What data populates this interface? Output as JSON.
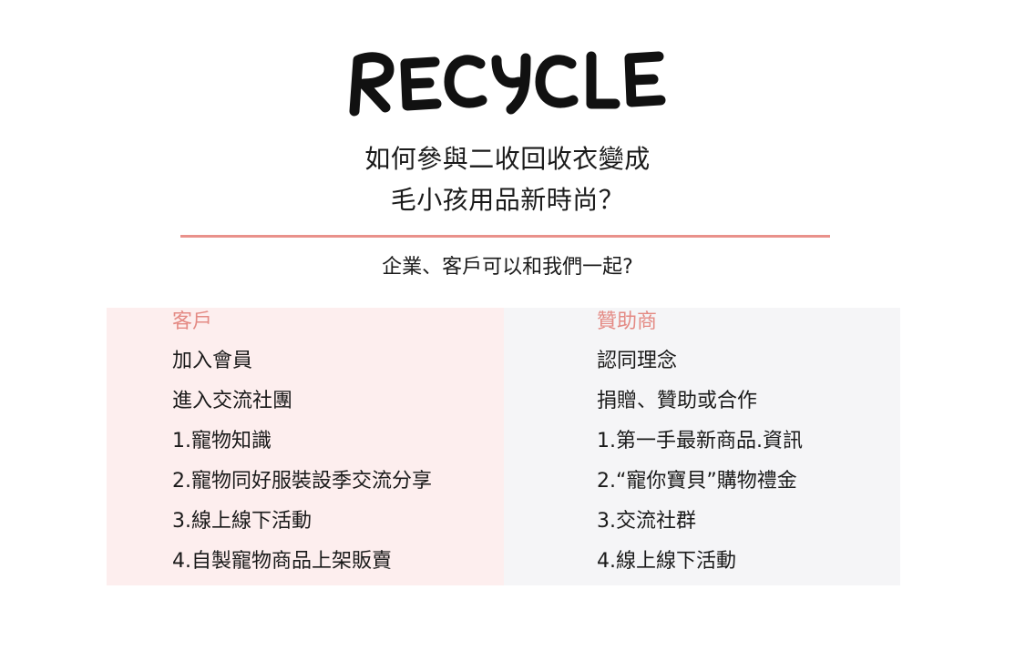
{
  "logo": {
    "text": "RECYCLE"
  },
  "heading": {
    "line1": "如何參與二收回收衣變成",
    "line2": "毛小孩用品新時尚？"
  },
  "question": "企業、客戶可以和我們一起?",
  "colors": {
    "accent": "#e9918b",
    "customer_bg": "#fdeeee",
    "sponsor_bg": "#f5f5f7",
    "column_heading": "#e48a84"
  },
  "customer": {
    "title": "客戶",
    "items": [
      "加入會員",
      "進入交流社團",
      "1.寵物知識",
      "2.寵物同好服裝設季交流分享",
      "3.線上線下活動",
      "4.自製寵物商品上架販賣"
    ]
  },
  "sponsor": {
    "title": "贊助商",
    "items": [
      "認同理念",
      "捐贈、贊助或合作",
      "1.第一手最新商品.資訊",
      "2.“寵你寶貝”購物禮金",
      "3.交流社群",
      "4.線上線下活動"
    ]
  }
}
